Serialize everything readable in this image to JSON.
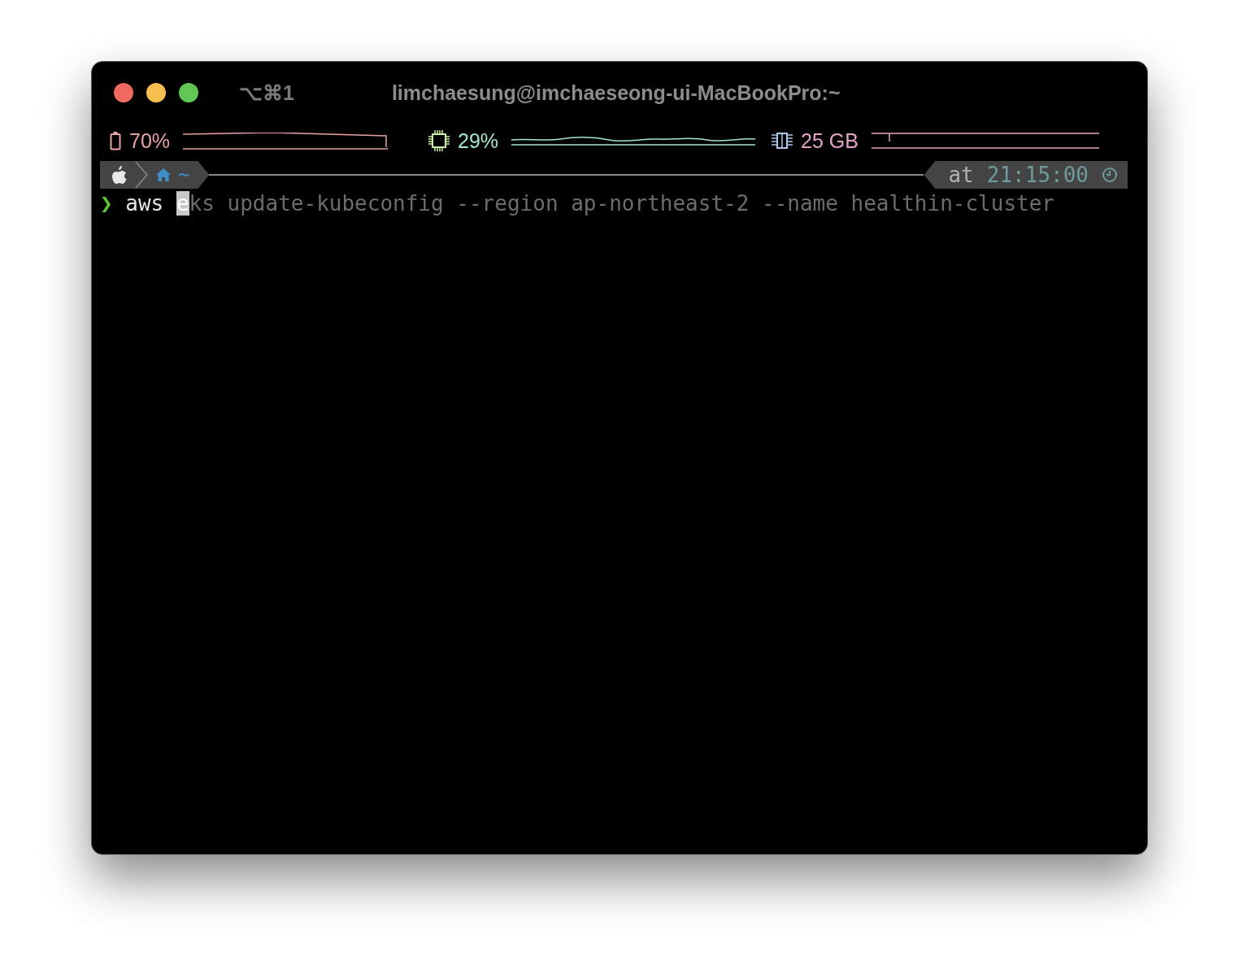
{
  "window": {
    "shortcut": "⌥⌘1",
    "title": "limchaesung@imchaeseong-ui-MacBookPro:~"
  },
  "status_bar": [
    {
      "kind": "battery",
      "value": "70%",
      "color": "#e6a3a3"
    },
    {
      "kind": "cpu",
      "value": "29%",
      "color": "#a3e6c8"
    },
    {
      "kind": "memory",
      "value": "25 GB",
      "color": "#e3a3c9"
    }
  ],
  "prompt": {
    "path": "~",
    "right_prefix": "at",
    "time": "21:15:00"
  },
  "command": {
    "symbol": "❯",
    "typed": "aws ",
    "cursor": "e",
    "suggestion": "ks update-kubeconfig --region ap-northeast-2 --name healthin-cluster"
  }
}
